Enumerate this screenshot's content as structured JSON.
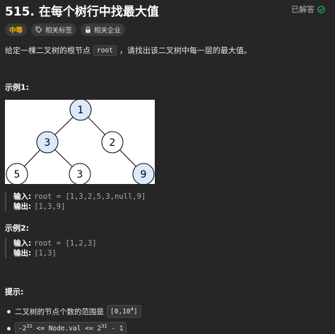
{
  "problem": {
    "title": "515. 在每个树行中找最大值",
    "solved_label": "已解答"
  },
  "tags": {
    "difficulty": "中等",
    "related_tags": "相关标签",
    "related_companies": "相关企业"
  },
  "description": {
    "before": "给定一棵二叉树的根节点",
    "code": "root",
    "after": "，请找出该二叉树中每一层的最大值。"
  },
  "example1": {
    "title": "示例1:",
    "input_label": "输入:",
    "input_value": "root = [1,3,2,5,3,null,9]",
    "output_label": "输出:",
    "output_value": "[1,3,9]",
    "tree_nodes": [
      "1",
      "3",
      "2",
      "5",
      "3",
      "9"
    ]
  },
  "example2": {
    "title": "示例2:",
    "input_label": "输入:",
    "input_value": "root = [1,2,3]",
    "output_label": "输出:",
    "output_value": "[1,3]"
  },
  "hints": {
    "title": "提示:",
    "item1_text": "二叉树的节点个数的范围是",
    "item1_code": "[0,10",
    "item1_sup": "4",
    "item1_end": "]",
    "item2_a": "-2",
    "item2_sup1": "31",
    "item2_b": " <= Node.val <= 2",
    "item2_sup2": "31",
    "item2_c": " - 1"
  },
  "colors": {
    "background": "#262626",
    "difficulty": "#ffb800",
    "solved_check": "#2cbb5d",
    "node_highlight": "#dce8fc"
  }
}
